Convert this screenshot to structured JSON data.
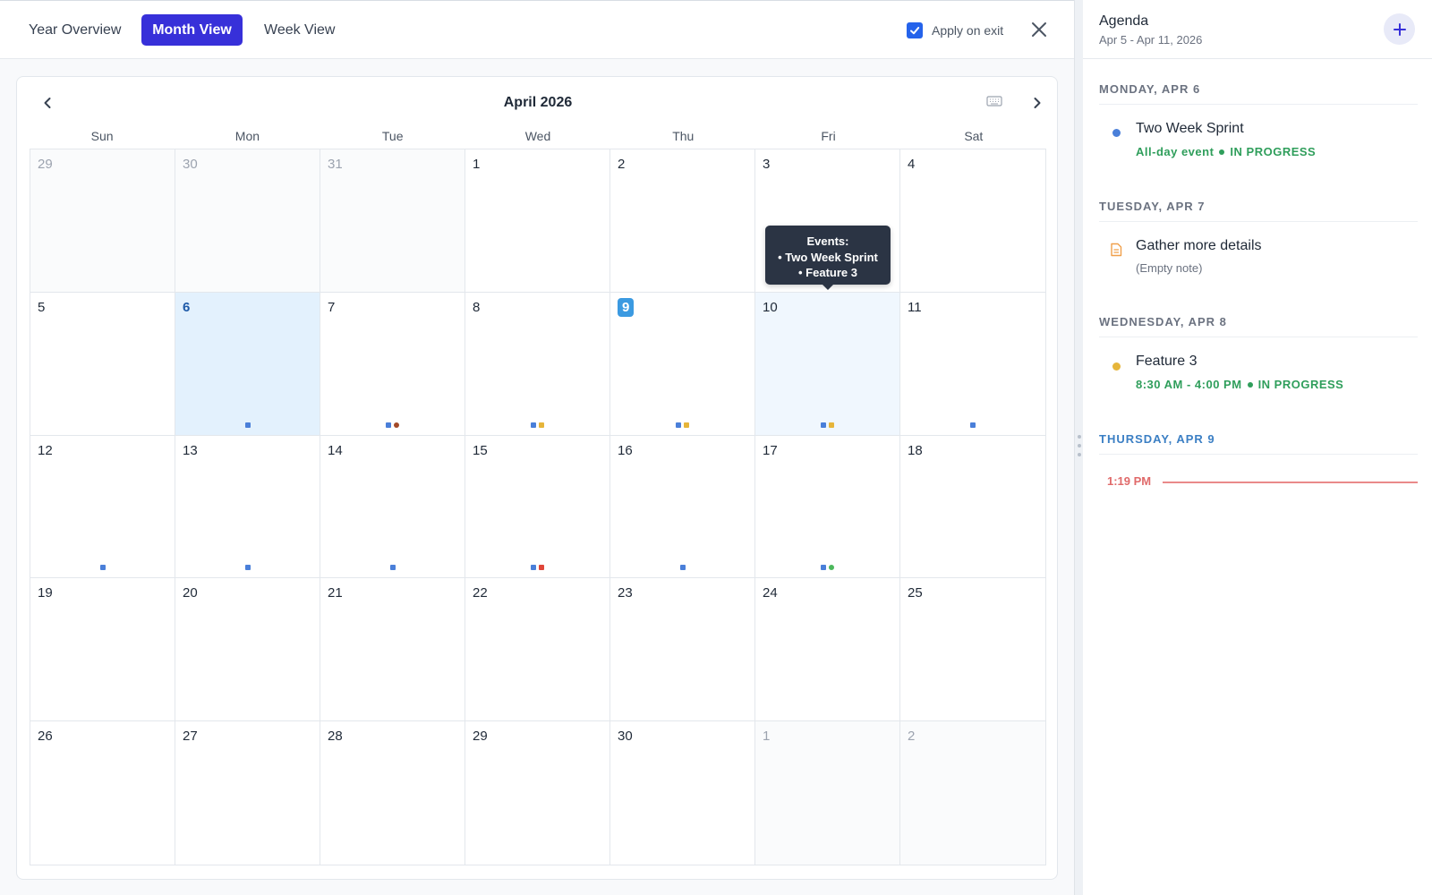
{
  "toolbar": {
    "tabs": [
      "Year Overview",
      "Month View",
      "Week View"
    ],
    "active_tab": "Month View",
    "apply_on_exit_label": "Apply on exit",
    "apply_on_exit_checked": true
  },
  "calendar": {
    "month_title": "April 2026",
    "weekdays": [
      "Sun",
      "Mon",
      "Tue",
      "Wed",
      "Thu",
      "Fri",
      "Sat"
    ],
    "today": "9",
    "selected_day": "6",
    "hovered_day": "10",
    "cells": [
      {
        "day": "29",
        "outside": true,
        "dots": []
      },
      {
        "day": "30",
        "outside": true,
        "dots": []
      },
      {
        "day": "31",
        "outside": true,
        "dots": []
      },
      {
        "day": "1",
        "dots": []
      },
      {
        "day": "2",
        "dots": []
      },
      {
        "day": "3",
        "dots": []
      },
      {
        "day": "4",
        "dots": []
      },
      {
        "day": "5",
        "dots": []
      },
      {
        "day": "6",
        "dots": [
          "#4a7fd9"
        ]
      },
      {
        "day": "7",
        "dots": [
          "#4a7fd9",
          "#a34a28"
        ]
      },
      {
        "day": "8",
        "dots": [
          "#4a7fd9",
          "#e6b53a"
        ]
      },
      {
        "day": "9",
        "dots": [
          "#4a7fd9",
          "#e6b53a"
        ]
      },
      {
        "day": "10",
        "dots": [
          "#4a7fd9",
          "#e6b53a"
        ]
      },
      {
        "day": "11",
        "dots": [
          "#4a7fd9"
        ]
      },
      {
        "day": "12",
        "dots": [
          "#4a7fd9"
        ]
      },
      {
        "day": "13",
        "dots": [
          "#4a7fd9"
        ]
      },
      {
        "day": "14",
        "dots": [
          "#4a7fd9"
        ]
      },
      {
        "day": "15",
        "dots": [
          "#4a7fd9",
          "#e0463a"
        ]
      },
      {
        "day": "16",
        "dots": [
          "#4a7fd9"
        ]
      },
      {
        "day": "17",
        "dots": [
          "#4a7fd9",
          "#4cb85c"
        ]
      },
      {
        "day": "18",
        "dots": []
      },
      {
        "day": "19",
        "dots": []
      },
      {
        "day": "20",
        "dots": []
      },
      {
        "day": "21",
        "dots": []
      },
      {
        "day": "22",
        "dots": []
      },
      {
        "day": "23",
        "dots": []
      },
      {
        "day": "24",
        "dots": []
      },
      {
        "day": "25",
        "dots": []
      },
      {
        "day": "26",
        "dots": []
      },
      {
        "day": "27",
        "dots": []
      },
      {
        "day": "28",
        "dots": []
      },
      {
        "day": "29",
        "dots": []
      },
      {
        "day": "30",
        "dots": []
      },
      {
        "day": "1",
        "outside": true,
        "dots": []
      },
      {
        "day": "2",
        "outside": true,
        "dots": []
      }
    ],
    "tooltip": {
      "heading": "Events:",
      "items": [
        "• Two Week Sprint",
        "• Feature 3"
      ]
    }
  },
  "agenda": {
    "title": "Agenda",
    "range": "Apr 5 - Apr 11, 2026",
    "days": [
      {
        "label": "MONDAY, APR 6",
        "event": {
          "title": "Two Week Sprint",
          "time": "All-day event",
          "status": "IN PROGRESS",
          "color": "#4a7fd9"
        }
      },
      {
        "label": "TUESDAY, APR 7",
        "event": {
          "title": "Gather more details",
          "note": "(Empty note)",
          "icon": "note-icon"
        }
      },
      {
        "label": "WEDNESDAY, APR 8",
        "event": {
          "title": "Feature 3",
          "time": "8:30 AM - 4:00 PM",
          "status": "IN PROGRESS",
          "color": "#e6b53a"
        }
      },
      {
        "label": "THURSDAY, APR 9",
        "now_time": "1:19 PM"
      }
    ]
  },
  "colors": {
    "accent": "#3730d9",
    "today": "#3b9ae1",
    "status_green": "#2f9e5b",
    "now_line": "#e06a6a"
  }
}
